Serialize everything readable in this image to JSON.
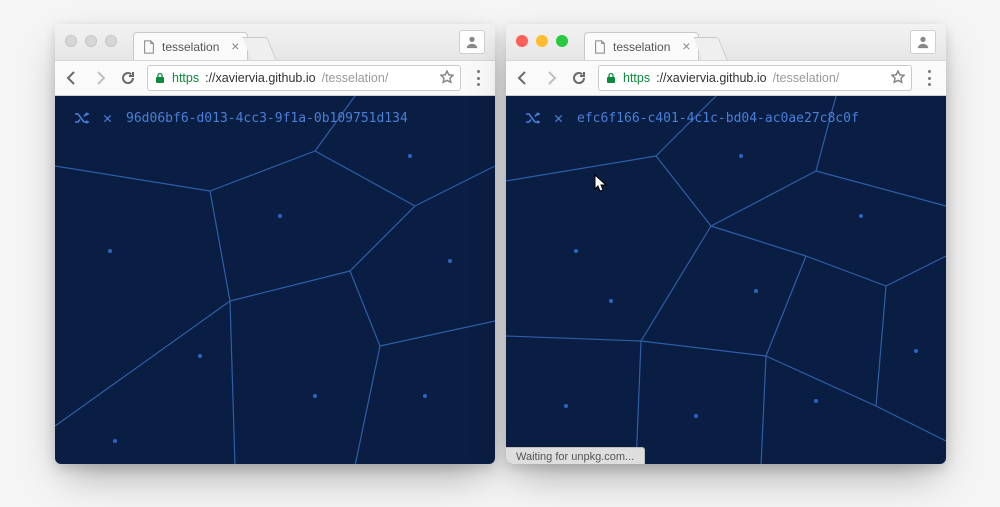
{
  "windows": [
    {
      "traffic_style": "dim",
      "tab_title": "tesselation",
      "url_proto": "https",
      "url_host": "://xaviervia.github.io",
      "url_path": "/tesselation/",
      "uuid": "96d06bf6-d013-4cc3-9f1a-0b109751d134",
      "status": ""
    },
    {
      "traffic_style": "color",
      "tab_title": "tesselation",
      "url_proto": "https",
      "url_host": "://xaviervia.github.io",
      "url_path": "/tesselation/",
      "uuid": "efc6f166-c401-4c1c-bd04-ac0ae27c8c0f",
      "status": "Waiting for unpkg.com..."
    }
  ],
  "icons": {
    "shuffle": "shuffle-icon",
    "close": "close-icon"
  },
  "colors": {
    "viewport_bg": "#091e42",
    "mesh_line": "#2f5ea8",
    "hud_text": "#4a7fd8"
  }
}
